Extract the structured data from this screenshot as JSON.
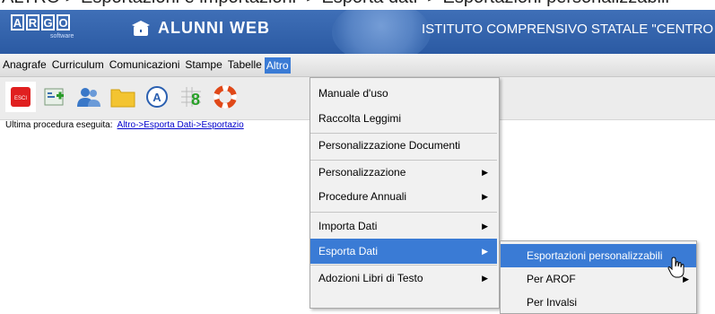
{
  "top_caption": "ALTRO > Esportazioni e importazioni  > Esporta dati  > Esportazioni personalizzabili",
  "header": {
    "logo_letters": [
      "A",
      "R",
      "G",
      "O"
    ],
    "logo_sub": "software",
    "product": "ALUNNI WEB",
    "school": "ISTITUTO COMPRENSIVO STATALE \"CENTRO"
  },
  "menubar": [
    "Anagrafe",
    "Curriculum",
    "Comunicazioni",
    "Stampe",
    "Tabelle",
    "Altro"
  ],
  "toolbar": {
    "esci_label": "ESCI",
    "icons": [
      "exit-icon",
      "add-student-icon",
      "users-icon",
      "folder-icon",
      "letter-a-icon",
      "grid-8-icon",
      "lifebuoy-icon"
    ]
  },
  "last_procedure": {
    "label": "Ultima procedura eseguita:",
    "link": "Altro->Esporta Dati->Esportazio"
  },
  "dropdown": {
    "items": [
      {
        "label": "Manuale d'uso",
        "arrow": ""
      },
      {
        "label": "Raccolta Leggimi",
        "arrow": ""
      },
      {
        "label": "Personalizzazione Documenti",
        "arrow": ""
      },
      {
        "label": "Personalizzazione",
        "arrow": "▶"
      },
      {
        "label": "Procedure Annuali",
        "arrow": "▶"
      },
      {
        "label": "Importa Dati",
        "arrow": "▶"
      },
      {
        "label": "Esporta Dati",
        "arrow": "▶"
      },
      {
        "label": "Adozioni Libri di Testo",
        "arrow": "▶"
      }
    ]
  },
  "submenu": {
    "items": [
      {
        "label": "Esportazioni personalizzabili",
        "arrow": ""
      },
      {
        "label": "Per AROF",
        "arrow": "▶"
      },
      {
        "label": "Per Invalsi",
        "arrow": ""
      }
    ]
  },
  "colors": {
    "accent": "#3a7bd5",
    "banner": "#2b5aa3"
  }
}
